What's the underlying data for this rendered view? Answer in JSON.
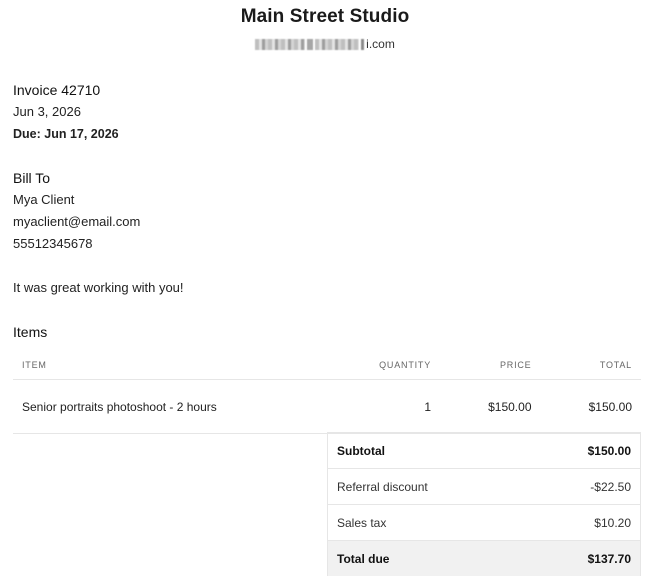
{
  "studio": {
    "name": "Main Street Studio",
    "email_suffix": "i.com"
  },
  "invoice": {
    "title": "Invoice 42710",
    "date": "Jun 3, 2026",
    "due": "Due: Jun 17, 2026"
  },
  "bill_to": {
    "heading": "Bill To",
    "name": "Mya Client",
    "email": "myaclient@email.com",
    "phone": "55512345678"
  },
  "message": "It was great working with you!",
  "items": {
    "heading": "Items",
    "columns": [
      "ITEM",
      "QUANTITY",
      "PRICE",
      "TOTAL"
    ],
    "rows": [
      {
        "item": "Senior portraits photoshoot - 2 hours",
        "quantity": "1",
        "price": "$150.00",
        "total": "$150.00"
      }
    ]
  },
  "totals": [
    {
      "label": "Subtotal",
      "value": "$150.00"
    },
    {
      "label": "Referral discount",
      "value": "-$22.50"
    },
    {
      "label": "Sales tax",
      "value": "$10.20"
    },
    {
      "label": "Total due",
      "value": "$137.70"
    }
  ]
}
